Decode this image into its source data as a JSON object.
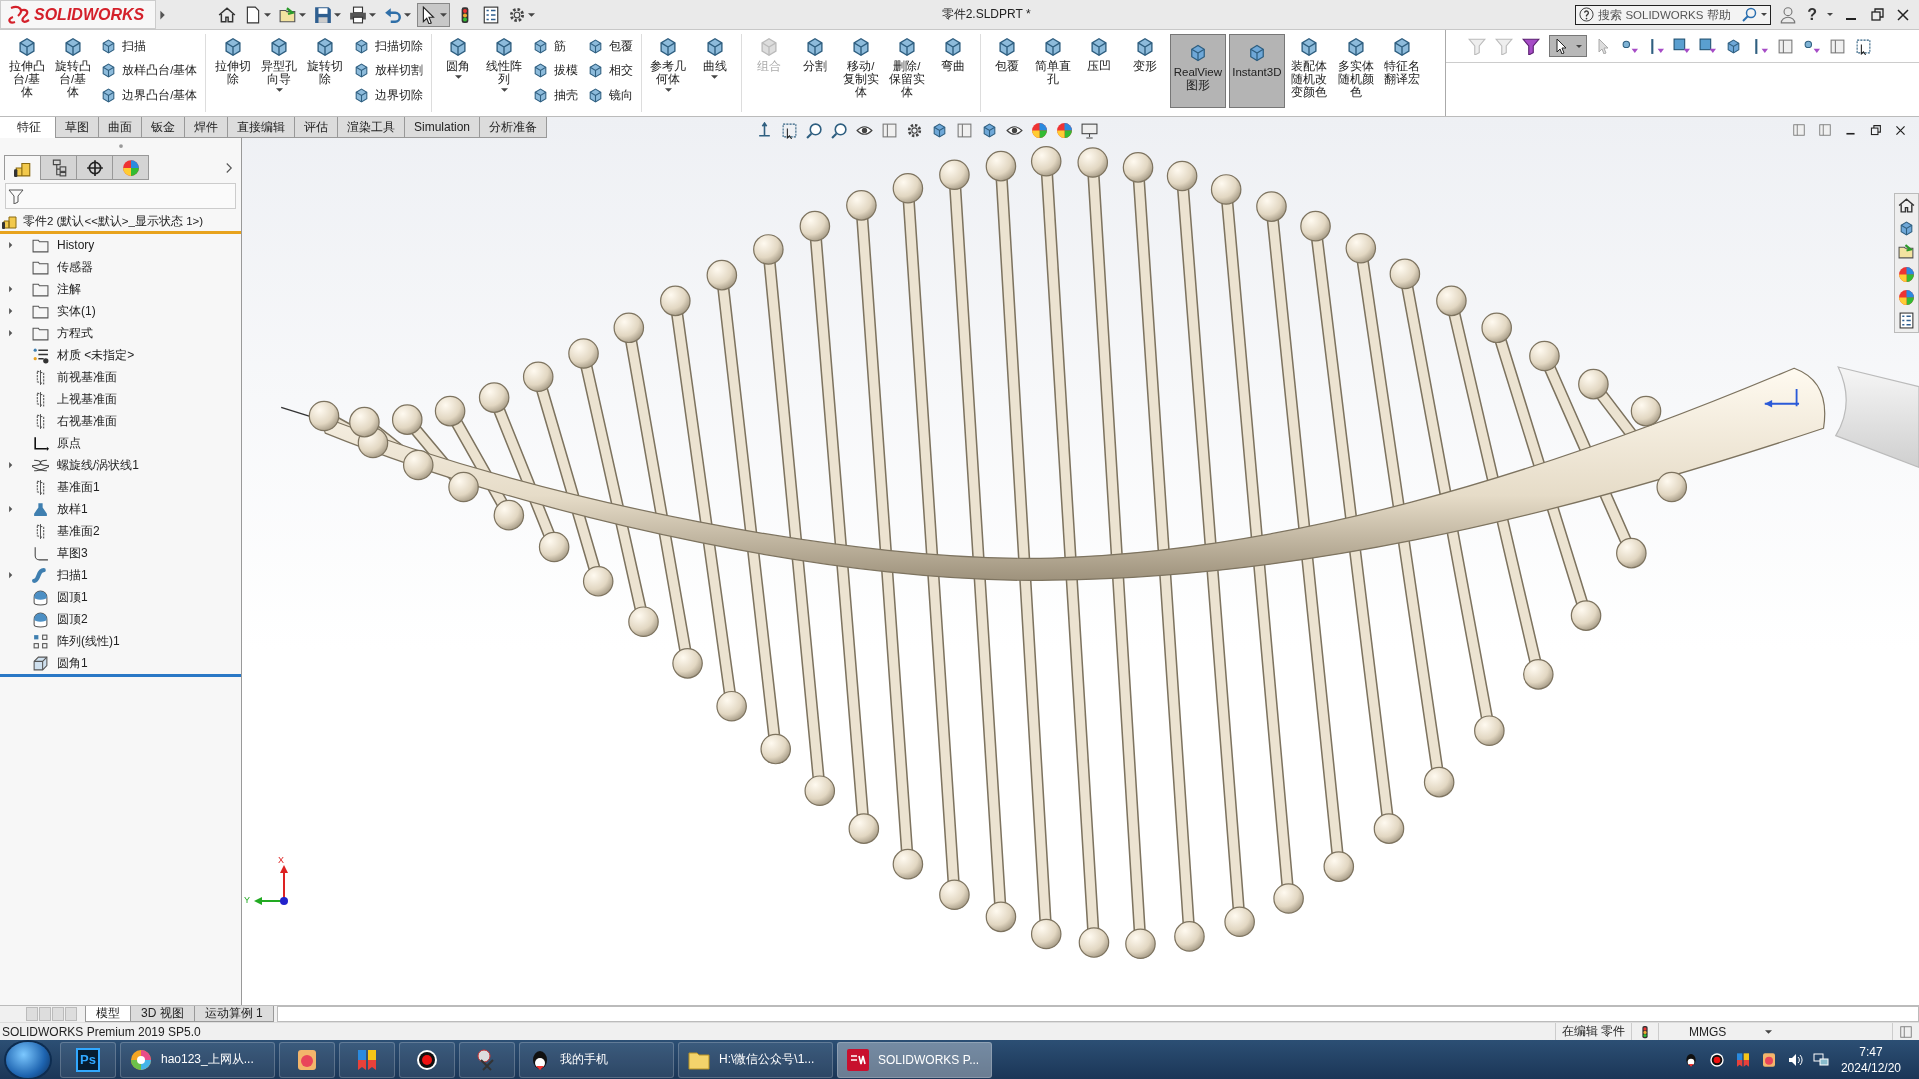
{
  "titlebar": {
    "logo": "SOLIDWORKS",
    "title": "零件2.SLDPRT *",
    "search": {
      "placeholder": "搜索 SOLIDWORKS 帮助"
    },
    "help": "?"
  },
  "ribbon": {
    "groups": [
      {
        "items": [
          {
            "kind": "large",
            "label": "拉伸凸台/基体",
            "dropdown": false
          },
          {
            "kind": "large",
            "label": "旋转凸台/基体",
            "dropdown": false
          },
          {
            "kind": "small",
            "label": "扫描"
          },
          {
            "kind": "small",
            "label": "放样凸台/基体"
          },
          {
            "kind": "small",
            "label": "边界凸台/基体"
          }
        ]
      },
      {
        "items": [
          {
            "kind": "large",
            "label": "拉伸切除",
            "dropdown": false
          },
          {
            "kind": "large",
            "label": "异型孔向导",
            "dropdown": true
          },
          {
            "kind": "large",
            "label": "旋转切除",
            "dropdown": false
          },
          {
            "kind": "small",
            "label": "扫描切除"
          },
          {
            "kind": "small",
            "label": "放样切割"
          },
          {
            "kind": "small",
            "label": "边界切除"
          }
        ]
      },
      {
        "items": [
          {
            "kind": "large",
            "label": "圆角",
            "dropdown": true
          },
          {
            "kind": "large",
            "label": "线性阵列",
            "dropdown": true
          },
          {
            "kind": "small",
            "label": "筋"
          },
          {
            "kind": "small",
            "label": "拔模"
          },
          {
            "kind": "small",
            "label": "抽壳"
          },
          {
            "kind": "small",
            "label": "包覆"
          },
          {
            "kind": "small",
            "label": "相交"
          },
          {
            "kind": "small",
            "label": "镜向"
          }
        ]
      },
      {
        "items": [
          {
            "kind": "large",
            "label": "参考几何体",
            "dropdown": true
          },
          {
            "kind": "large",
            "label": "曲线",
            "dropdown": true
          }
        ]
      },
      {
        "items": [
          {
            "kind": "large",
            "label": "组合",
            "dropdown": false,
            "disabled": true
          },
          {
            "kind": "large",
            "label": "分割",
            "dropdown": false
          },
          {
            "kind": "large",
            "label": "移动/复制实体",
            "dropdown": false
          },
          {
            "kind": "large",
            "label": "删除/保留实体",
            "dropdown": false
          },
          {
            "kind": "large",
            "label": "弯曲",
            "dropdown": false
          }
        ]
      },
      {
        "items": [
          {
            "kind": "large",
            "label": "包覆",
            "dropdown": false
          },
          {
            "kind": "large",
            "label": "简单直孔",
            "dropdown": false
          },
          {
            "kind": "large",
            "label": "压凹",
            "dropdown": false
          },
          {
            "kind": "large",
            "label": "变形",
            "dropdown": false
          },
          {
            "kind": "toggle",
            "label": "RealView图形",
            "selected": true
          },
          {
            "kind": "toggle",
            "label": "Instant3D",
            "selected": true
          },
          {
            "kind": "large",
            "label": "装配体随机改变颜色",
            "dropdown": false
          },
          {
            "kind": "large",
            "label": "多实体随机颜色",
            "dropdown": false
          },
          {
            "kind": "large",
            "label": "特征名翻译宏",
            "dropdown": false
          }
        ]
      }
    ]
  },
  "command_tabs": [
    {
      "label": "特征",
      "selected": true
    },
    {
      "label": "草图",
      "selected": false
    },
    {
      "label": "曲面",
      "selected": false
    },
    {
      "label": "钣金",
      "selected": false
    },
    {
      "label": "焊件",
      "selected": false
    },
    {
      "label": "直接编辑",
      "selected": false
    },
    {
      "label": "评估",
      "selected": false
    },
    {
      "label": "渲染工具",
      "selected": false
    },
    {
      "label": "Simulation",
      "selected": false
    },
    {
      "label": "分析准备",
      "selected": false
    }
  ],
  "panel_tabs": [
    {
      "kind": "features",
      "selected": true
    },
    {
      "kind": "properties",
      "selected": false
    },
    {
      "kind": "config",
      "selected": false
    },
    {
      "kind": "display",
      "selected": false
    }
  ],
  "tree": {
    "root": "零件2 (默认<<默认>_显示状态 1>)",
    "items": [
      {
        "kind": "history",
        "label": "History",
        "collapsed": true
      },
      {
        "kind": "sensor",
        "label": "传感器",
        "collapsed": false
      },
      {
        "kind": "annotation",
        "label": "注解",
        "collapsed": true
      },
      {
        "kind": "solid",
        "label": "实体(1)",
        "collapsed": true
      },
      {
        "kind": "equation",
        "label": "方程式",
        "collapsed": true
      },
      {
        "kind": "material",
        "label": "材质 <未指定>",
        "collapsed": false
      },
      {
        "kind": "plane",
        "label": "前视基准面",
        "collapsed": false
      },
      {
        "kind": "plane",
        "label": "上视基准面",
        "collapsed": false
      },
      {
        "kind": "plane",
        "label": "右视基准面",
        "collapsed": false
      },
      {
        "kind": "origin",
        "label": "原点",
        "collapsed": false
      },
      {
        "kind": "helix",
        "label": "螺旋线/涡状线1",
        "collapsed": true
      },
      {
        "kind": "plane",
        "label": "基准面1",
        "collapsed": false
      },
      {
        "kind": "loft",
        "label": "放样1",
        "collapsed": true
      },
      {
        "kind": "plane",
        "label": "基准面2",
        "collapsed": false
      },
      {
        "kind": "sketch",
        "label": "草图3",
        "collapsed": false
      },
      {
        "kind": "sweep",
        "label": "扫描1",
        "collapsed": true
      },
      {
        "kind": "dome",
        "label": "圆顶1",
        "collapsed": false
      },
      {
        "kind": "dome",
        "label": "圆顶2",
        "collapsed": false
      },
      {
        "kind": "pattern",
        "label": "阵列(线性)1",
        "collapsed": false
      },
      {
        "kind": "fillet",
        "label": "圆角1",
        "collapsed": false
      }
    ]
  },
  "triad": {
    "x_label": "X",
    "y_label": "Y"
  },
  "model_tabs": [
    {
      "label": "模型",
      "selected": true
    },
    {
      "label": "3D 视图",
      "selected": false
    },
    {
      "label": "运动算例 1",
      "selected": false
    }
  ],
  "status_bar": {
    "product": "SOLIDWORKS Premium 2019 SP5.0",
    "mode": "在编辑 零件",
    "units": "MMGS"
  },
  "taskbar": {
    "items": [
      {
        "kind": "photoshop",
        "label": "Ps",
        "selected": false
      },
      {
        "kind": "browser",
        "label": "hao123_上网从...",
        "selected": false
      },
      {
        "kind": "gallery",
        "selected": false
      },
      {
        "kind": "tiles",
        "selected": false
      },
      {
        "kind": "record",
        "selected": false
      },
      {
        "kind": "scissors",
        "selected": false
      },
      {
        "kind": "qq",
        "label": "我的手机",
        "selected": false
      },
      {
        "kind": "folder",
        "label": "H:\\微信公众号\\1...",
        "selected": false
      },
      {
        "kind": "solidworks",
        "label": "SOLIDWORKS P...",
        "selected": true
      }
    ],
    "time": "7:47",
    "date": "2024/12/20"
  }
}
